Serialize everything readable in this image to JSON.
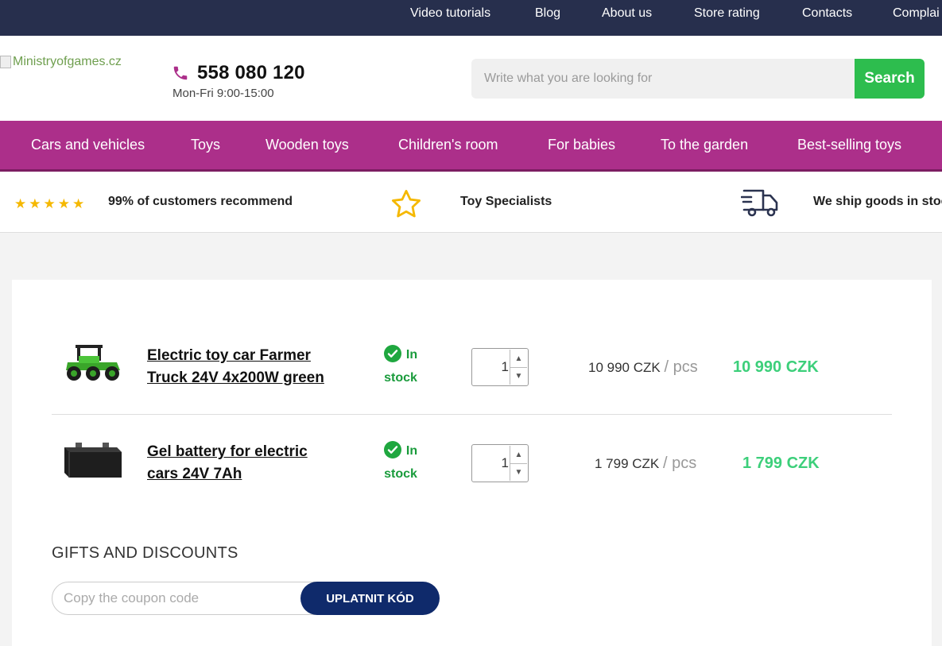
{
  "topnav": {
    "items": [
      "Video tutorials",
      "Blog",
      "About us",
      "Store rating",
      "Contacts",
      "Complai"
    ]
  },
  "header": {
    "logo_alt": "Ministryofgames.cz",
    "phone": "558 080 120",
    "hours": "Mon-Fri 9:00-15:00",
    "search_placeholder": "Write what you are looking for",
    "search_label": "Search"
  },
  "categories": [
    "Cars and vehicles",
    "Toys",
    "Wooden toys",
    "Children's room",
    "For babies",
    "To the garden",
    "Best-selling toys"
  ],
  "benefits": {
    "rating_stars": 5,
    "recommend": "99% of customers recommend",
    "specialists": "Toy Specialists",
    "shipping": "We ship goods in stoc"
  },
  "cart": {
    "items": [
      {
        "name_line1": "Electric toy car Farmer",
        "name_line2": "Truck 24V 4x200W green",
        "stock_line1": "In",
        "stock_line2": "stock",
        "qty": "1",
        "unit_price": "10 990 CZK",
        "unit_suffix": "/ pcs",
        "total": "10 990 CZK"
      },
      {
        "name_line1": "Gel battery for electric",
        "name_line2": "cars 24V 7Ah",
        "stock_line1": "In",
        "stock_line2": "stock",
        "qty": "1",
        "unit_price": "1 799 CZK",
        "unit_suffix": "/ pcs",
        "total": "1 799 CZK"
      }
    ]
  },
  "gifts": {
    "heading": "GIFTS AND DISCOUNTS",
    "coupon_placeholder": "Copy the coupon code",
    "apply_label": "UPLATNIT KÓD"
  },
  "colors": {
    "topbar": "#272f4d",
    "category_nav": "#ac2f8a",
    "search_button": "#2dbd4e",
    "in_stock": "#199b3b",
    "total_price": "#3ccf7a",
    "coupon_button": "#0f2a6b"
  }
}
